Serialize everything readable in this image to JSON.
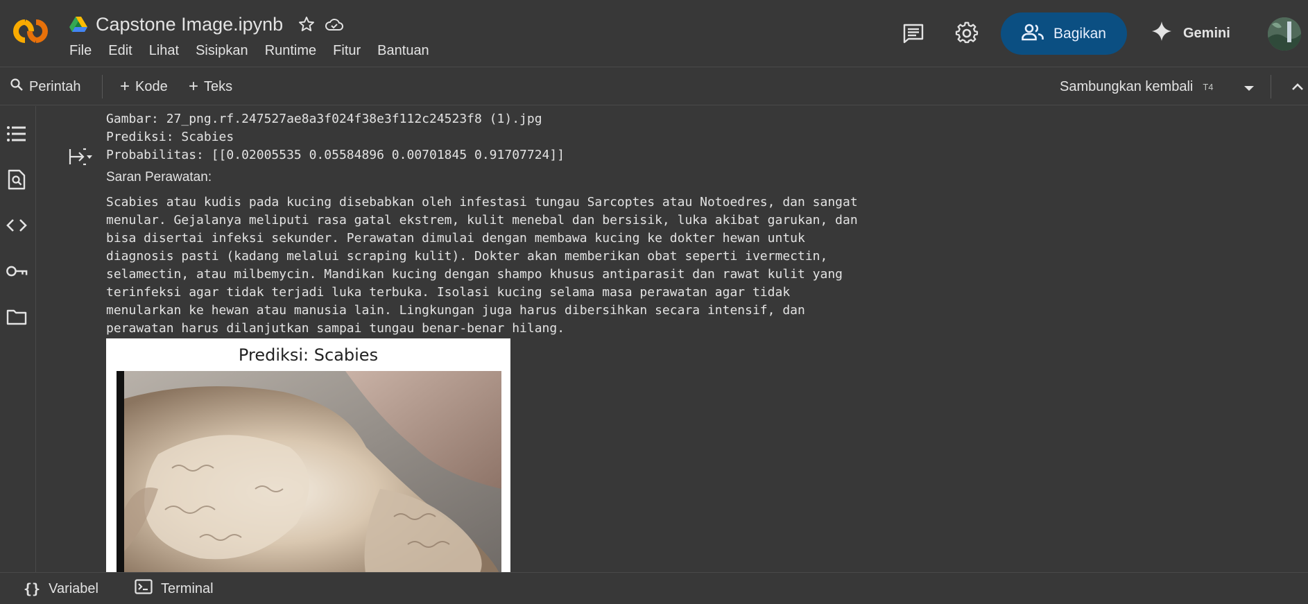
{
  "app": {
    "doc_title": "Capstone Image.ipynb",
    "menu": [
      "File",
      "Edit",
      "Lihat",
      "Sisipkan",
      "Runtime",
      "Fitur",
      "Bantuan"
    ],
    "share_label": "Bagikan",
    "gemini_label": "Gemini",
    "accent_color": "#0b4f82",
    "logo_color": "#f9ab00"
  },
  "toolbar": {
    "commands_label": "Perintah",
    "add_code_label": "Kode",
    "add_text_label": "Teks",
    "runtime_label": "Sambungkan kembali",
    "runtime_type": "T4"
  },
  "output": {
    "image_line": "Gambar: 27_png.rf.247527ae8a3f024f38e3f112c24523f8 (1).jpg",
    "prediction_line": "Prediksi: Scabies",
    "probability_line": "Probabilitas: [[0.02005535 0.05584896 0.00701845 0.91707724]]",
    "advice_heading": "Saran Perawatan:",
    "advice_lines": [
      "Scabies atau kudis pada kucing disebabkan oleh infestasi tungau Sarcoptes atau Notoedres, dan sangat",
      "menular. Gejalanya meliputi rasa gatal ekstrem, kulit menebal dan bersisik, luka akibat garukan, dan",
      "bisa disertai infeksi sekunder. Perawatan dimulai dengan membawa kucing ke dokter hewan untuk",
      "diagnosis pasti (kadang melalui scraping kulit). Dokter akan memberikan obat seperti ivermectin,",
      "selamectin, atau milbemycin. Mandikan kucing dengan shampo khusus antiparasit dan rawat kulit yang",
      "terinfeksi agar tidak terjadi luka terbuka. Isolasi kucing selama masa perawatan agar tidak",
      "menularkan ke hewan atau manusia lain. Lingkungan juga harus dibersihkan secara intensif, dan",
      "perawatan harus dilanjutkan sampai tungau benar-benar hilang."
    ],
    "figure_title": "Prediksi: Scabies"
  },
  "bottom": {
    "variables_label": "Variabel",
    "terminal_label": "Terminal"
  },
  "icons": [
    "colab-logo-icon",
    "drive-icon",
    "star-icon",
    "cloud-icon",
    "comment-icon",
    "gear-icon",
    "people-icon",
    "sparkle-icon",
    "search-icon",
    "plus-icon",
    "chevron-down-icon",
    "chevron-up-icon",
    "toc-icon",
    "find-icon",
    "code-icon",
    "key-icon",
    "folder-icon",
    "output-icon",
    "braces-icon",
    "terminal-icon"
  ]
}
